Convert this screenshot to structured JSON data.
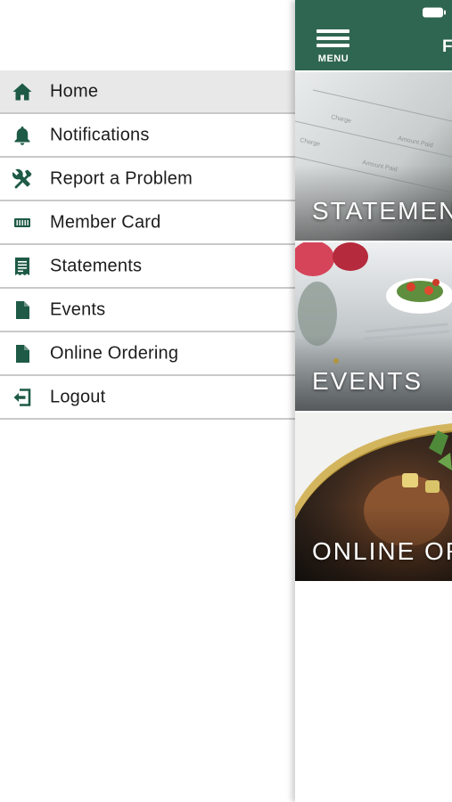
{
  "menu": {
    "items": [
      {
        "label": "Home",
        "icon": "home-icon",
        "active": true
      },
      {
        "label": "Notifications",
        "icon": "bell-icon",
        "active": false
      },
      {
        "label": "Report a Problem",
        "icon": "tools-icon",
        "active": false
      },
      {
        "label": "Member Card",
        "icon": "card-icon",
        "active": false
      },
      {
        "label": "Statements",
        "icon": "statement-icon",
        "active": false
      },
      {
        "label": "Events",
        "icon": "document-icon",
        "active": false
      },
      {
        "label": "Online Ordering",
        "icon": "document-icon",
        "active": false
      },
      {
        "label": "Logout",
        "icon": "logout-icon",
        "active": false
      }
    ]
  },
  "header": {
    "menu_label": "MENU",
    "title": "F"
  },
  "tiles": [
    {
      "label": "STATEMENTS"
    },
    {
      "label": "EVENTS"
    },
    {
      "label": "ONLINE ORDERING"
    }
  ],
  "colors": {
    "brand": "#2f6652",
    "icon": "#1e5a45",
    "active_row": "#e8e8e8",
    "divider": "#c9c9c9"
  }
}
